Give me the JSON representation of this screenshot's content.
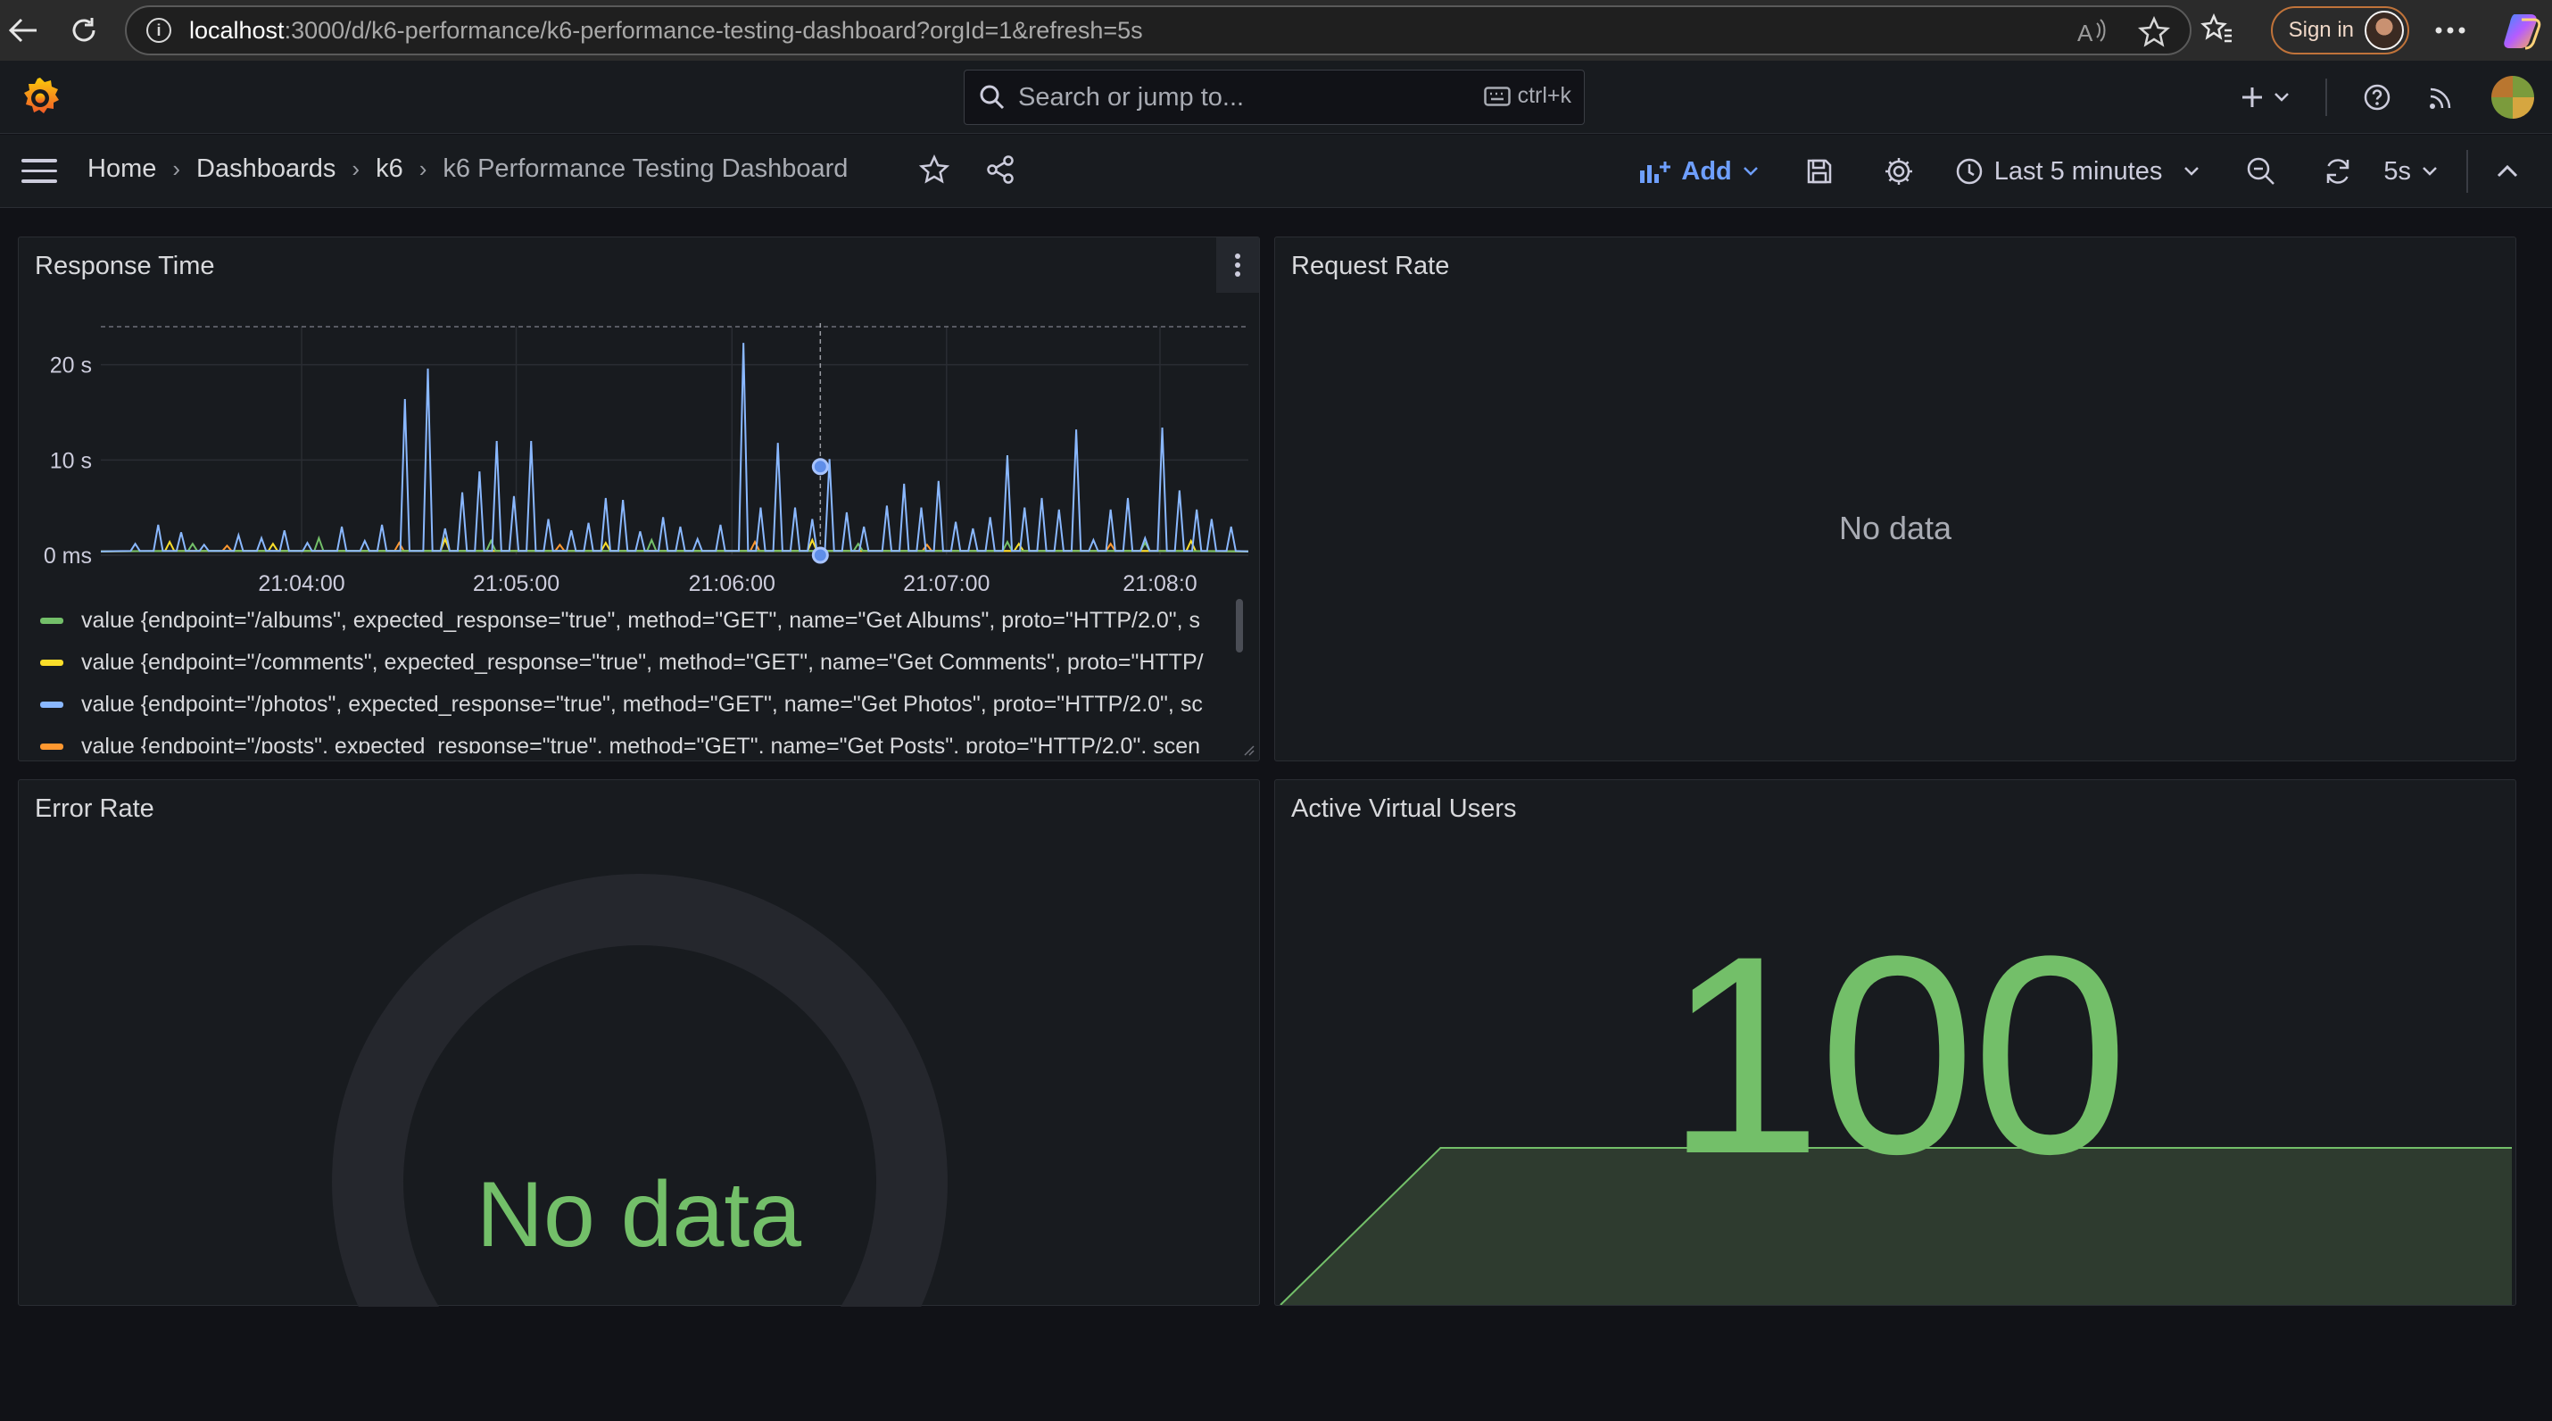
{
  "browser": {
    "url_host": "localhost",
    "url_path": ":3000/d/k6-performance/k6-performance-testing-dashboard?orgId=1&refresh=5s",
    "sign_in_label": "Sign in"
  },
  "grafana": {
    "search_placeholder": "Search or jump to...",
    "search_shortcut": "ctrl+k",
    "breadcrumbs": [
      "Home",
      "Dashboards",
      "k6",
      "k6 Performance Testing Dashboard"
    ],
    "toolbar": {
      "add_label": "Add",
      "time_range": "Last 5 minutes",
      "refresh_interval": "5s"
    }
  },
  "panels": {
    "response_time": {
      "title": "Response Time",
      "legend": [
        {
          "label": "value {endpoint=\"/albums\", expected_response=\"true\", method=\"GET\", name=\"Get Albums\", proto=\"HTTP/2.0\", s",
          "color": "#73bf69"
        },
        {
          "label": "value {endpoint=\"/comments\", expected_response=\"true\", method=\"GET\", name=\"Get Comments\", proto=\"HTTP/",
          "color": "#fade2a"
        },
        {
          "label": "value {endpoint=\"/photos\", expected_response=\"true\", method=\"GET\", name=\"Get Photos\", proto=\"HTTP/2.0\", sc",
          "color": "#8ab8ff"
        },
        {
          "label": "value {endpoint=\"/posts\", expected_response=\"true\", method=\"GET\", name=\"Get Posts\", proto=\"HTTP/2.0\", scen",
          "color": "#ff9830"
        }
      ]
    },
    "request_rate": {
      "title": "Request Rate",
      "no_data": "No data"
    },
    "error_rate": {
      "title": "Error Rate",
      "no_data": "No data"
    },
    "active_vus": {
      "title": "Active Virtual Users",
      "value": "100"
    }
  },
  "chart_data": {
    "type": "line",
    "y_ticks": [
      "0 ms",
      "10 s",
      "20 s"
    ],
    "x_ticks": [
      "21:04:00",
      "21:05:00",
      "21:06:00",
      "21:07:00",
      "21:08:0"
    ],
    "ylim": [
      0,
      24
    ],
    "series": [
      {
        "name": "/photos",
        "color": "#8ab8ff",
        "peaks": [
          [
            0.03,
            1.2
          ],
          [
            0.05,
            3.2
          ],
          [
            0.07,
            2.4
          ],
          [
            0.09,
            1.1
          ],
          [
            0.12,
            2.1
          ],
          [
            0.14,
            1.8
          ],
          [
            0.16,
            2.6
          ],
          [
            0.18,
            1.3
          ],
          [
            0.21,
            3.0
          ],
          [
            0.23,
            1.5
          ],
          [
            0.245,
            3.2
          ],
          [
            0.265,
            16.4
          ],
          [
            0.285,
            19.6
          ],
          [
            0.3,
            2.8
          ],
          [
            0.315,
            6.6
          ],
          [
            0.33,
            8.8
          ],
          [
            0.345,
            12.0
          ],
          [
            0.36,
            6.2
          ],
          [
            0.375,
            12.0
          ],
          [
            0.39,
            3.8
          ],
          [
            0.41,
            2.6
          ],
          [
            0.425,
            3.4
          ],
          [
            0.44,
            6.0
          ],
          [
            0.455,
            5.8
          ],
          [
            0.47,
            2.5
          ],
          [
            0.49,
            4.0
          ],
          [
            0.505,
            3.0
          ],
          [
            0.52,
            1.7
          ],
          [
            0.54,
            3.2
          ],
          [
            0.56,
            22.3
          ],
          [
            0.575,
            5.0
          ],
          [
            0.59,
            11.8
          ],
          [
            0.605,
            5.0
          ],
          [
            0.62,
            3.8
          ],
          [
            0.635,
            10.1
          ],
          [
            0.65,
            4.5
          ],
          [
            0.665,
            3.0
          ],
          [
            0.685,
            5.2
          ],
          [
            0.7,
            7.5
          ],
          [
            0.715,
            5.0
          ],
          [
            0.73,
            7.8
          ],
          [
            0.745,
            3.5
          ],
          [
            0.76,
            2.8
          ],
          [
            0.775,
            4.0
          ],
          [
            0.79,
            10.5
          ],
          [
            0.805,
            5.0
          ],
          [
            0.82,
            6.0
          ],
          [
            0.835,
            4.8
          ],
          [
            0.85,
            13.2
          ],
          [
            0.865,
            1.6
          ],
          [
            0.88,
            4.8
          ],
          [
            0.895,
            6.0
          ],
          [
            0.91,
            1.8
          ],
          [
            0.925,
            13.4
          ],
          [
            0.94,
            6.8
          ],
          [
            0.955,
            4.8
          ],
          [
            0.968,
            3.8
          ],
          [
            0.985,
            3.0
          ]
        ]
      },
      {
        "name": "/albums",
        "color": "#73bf69",
        "peaks": [
          [
            0.08,
            1.2
          ],
          [
            0.19,
            1.8
          ],
          [
            0.34,
            1.5
          ],
          [
            0.48,
            1.6
          ],
          [
            0.66,
            1.2
          ],
          [
            0.79,
            1.4
          ],
          [
            0.91,
            1.3
          ]
        ]
      },
      {
        "name": "/comments",
        "color": "#fade2a",
        "peaks": [
          [
            0.06,
            1.4
          ],
          [
            0.15,
            1.2
          ],
          [
            0.3,
            1.7
          ],
          [
            0.44,
            1.3
          ],
          [
            0.62,
            1.6
          ],
          [
            0.8,
            1.2
          ],
          [
            0.95,
            1.5
          ]
        ]
      },
      {
        "name": "/posts",
        "color": "#ff9830",
        "peaks": [
          [
            0.11,
            1.0
          ],
          [
            0.26,
            1.3
          ],
          [
            0.4,
            1.1
          ],
          [
            0.57,
            1.4
          ],
          [
            0.72,
            1.1
          ],
          [
            0.88,
            1.2
          ]
        ]
      }
    ],
    "crosshair": {
      "x": 0.627,
      "y": 9.3
    },
    "threshold_y": 24
  },
  "vu_chart": {
    "type": "area",
    "color": "#73bf69",
    "points": [
      [
        0.0,
        0
      ],
      [
        0.13,
        100
      ],
      [
        1.0,
        100
      ]
    ],
    "ylim": [
      0,
      105
    ]
  }
}
